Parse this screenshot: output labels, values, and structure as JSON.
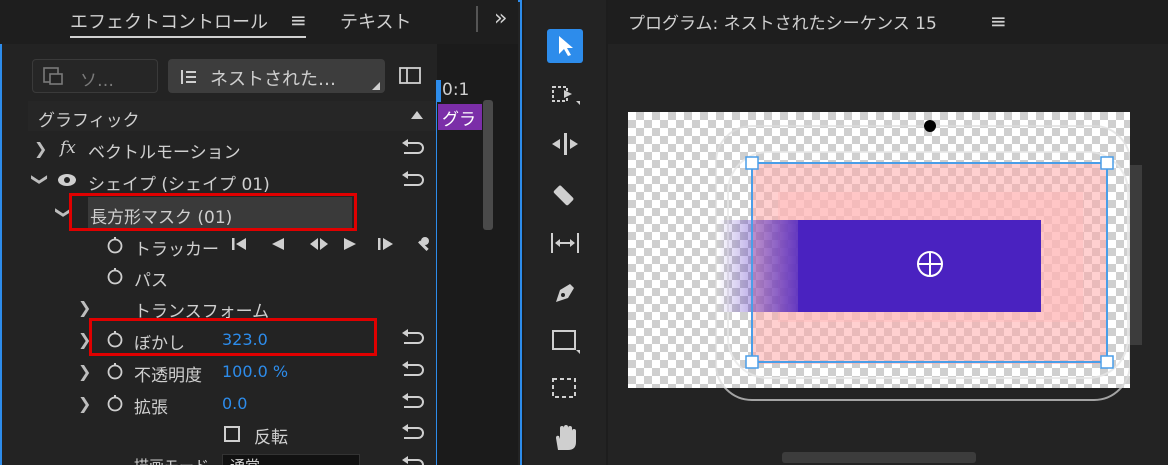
{
  "effect_controls": {
    "tab_label": "エフェクトコントロール",
    "menu_glyph": "≡",
    "tab_text_label": "テキスト",
    "overflow": "»",
    "source_label": "ソ…",
    "sequence_label": "ネストされた…",
    "timecode": "0:1",
    "clip_label": "グラ",
    "section_graphic": "グラフィック",
    "rows": {
      "vector_motion": "ベクトルモーション",
      "shape": "シェイプ (シェイプ 01)",
      "rect_mask": "長方形マスク (01)",
      "tracker": "トラッカー",
      "path": "パス",
      "transform": "トランスフォーム",
      "blur_label": "ぼかし",
      "blur_value": "323.0",
      "opacity_label": "不透明度",
      "opacity_value": "100.0 %",
      "expand_label": "拡張",
      "expand_value": "0.0",
      "invert_label": "反転",
      "blend_label": "描画モード",
      "blend_value": "通常"
    },
    "fx_glyph": "fx"
  },
  "program_monitor": {
    "title": "プログラム: ネストされたシーケンス 15",
    "menu_glyph": "≡"
  },
  "tools": {
    "icons": [
      "selection-tool-icon",
      "track-select-tool-icon",
      "ripple-edit-tool-icon",
      "razor-tool-icon",
      "slip-tool-icon",
      "pen-tool-icon",
      "rectangle-tool-icon",
      "marquee-tool-icon",
      "hand-tool-icon"
    ],
    "active": "selection-tool-icon"
  },
  "colors": {
    "accent": "#2d8ceb",
    "shape_fill": "#4a22c0",
    "mask_tint": "#ffaaaa",
    "highlight": "#e00000"
  }
}
